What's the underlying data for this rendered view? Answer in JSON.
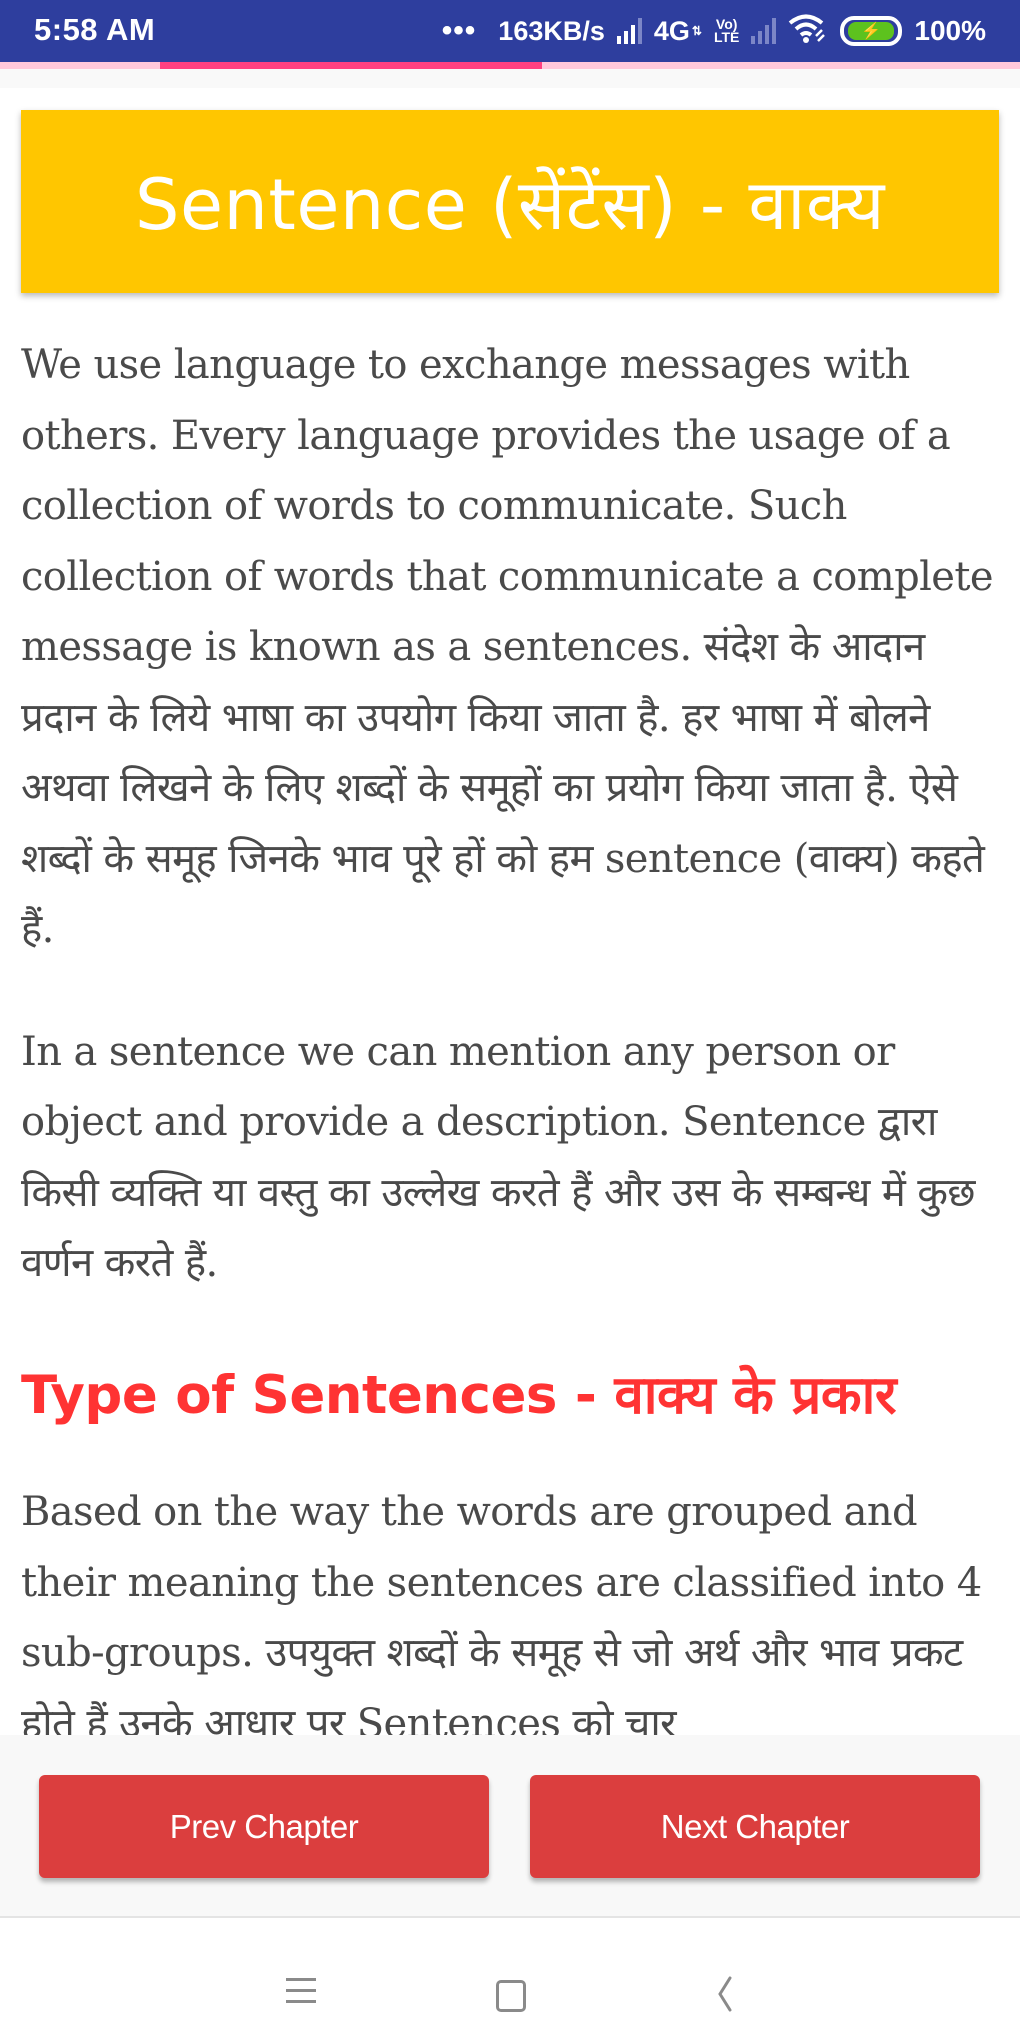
{
  "status_bar": {
    "time": "5:58 AM",
    "overflow": "•••",
    "net_speed": "163KB/s",
    "network_type": "4G",
    "network_arrows": "⇅",
    "volte_top": "Vo)",
    "volte_bottom": "LTE",
    "battery_icon": "⚡",
    "battery_percent": "100%",
    "icons": [
      "signal-icon",
      "4g-icon",
      "volte-icon",
      "no-signal-icon",
      "wifi-icon",
      "battery-charging-icon"
    ]
  },
  "loading_progress": {
    "segment_start_fraction": 0.157,
    "segment_end_fraction": 0.531
  },
  "title": "Sentence (सेंटेंस) - वाक्य",
  "paragraphs": [
    "We use language to exchange messages with others. Every language provides the usage of a collection of words to communicate. Such collection of words that communicate a complete message is known as a sentences. संदेश के आदान प्रदान के लिये भाषा का उपयोग किया जाता है. हर भाषा में बोलने अथवा लिखने के लिए शब्दों के समूहों का प्रयोग किया जाता है. ऐसे शब्दों के समूह जिनके भाव पूरे हों को हम sentence (वाक्य) कहते हैं.",
    "In a sentence we can mention any person or object and provide a description. Sentence द्वारा किसी व्यक्ति या वस्तु का उल्लेख करते हैं और उस के सम्बन्ध में कुछ वर्णन करते हैं."
  ],
  "section_heading": "Type of Sentences - वाक्य के प्रकार",
  "section_paragraph": "Based on the way the words are grouped and their meaning the sentences are classified into 4 sub-groups. उपयुक्त शब्दों के समूह से जो अर्थ और भाव प्रकट होते हैं उनके आधार पर Sentences को चार",
  "buttons": {
    "prev": "Prev Chapter",
    "next": "Next Chapter"
  },
  "colors": {
    "status_bar": "#2E3E9E",
    "progress_track": "#FFC8DB",
    "progress_segment": "#FF4081",
    "title_card": "#FFC600",
    "heading": "#FF3333",
    "body_text": "#4A4A4A",
    "button": "#DB3E3E"
  },
  "nav_bar": {
    "icons": [
      "menu-icon",
      "home-icon",
      "back-icon"
    ]
  }
}
